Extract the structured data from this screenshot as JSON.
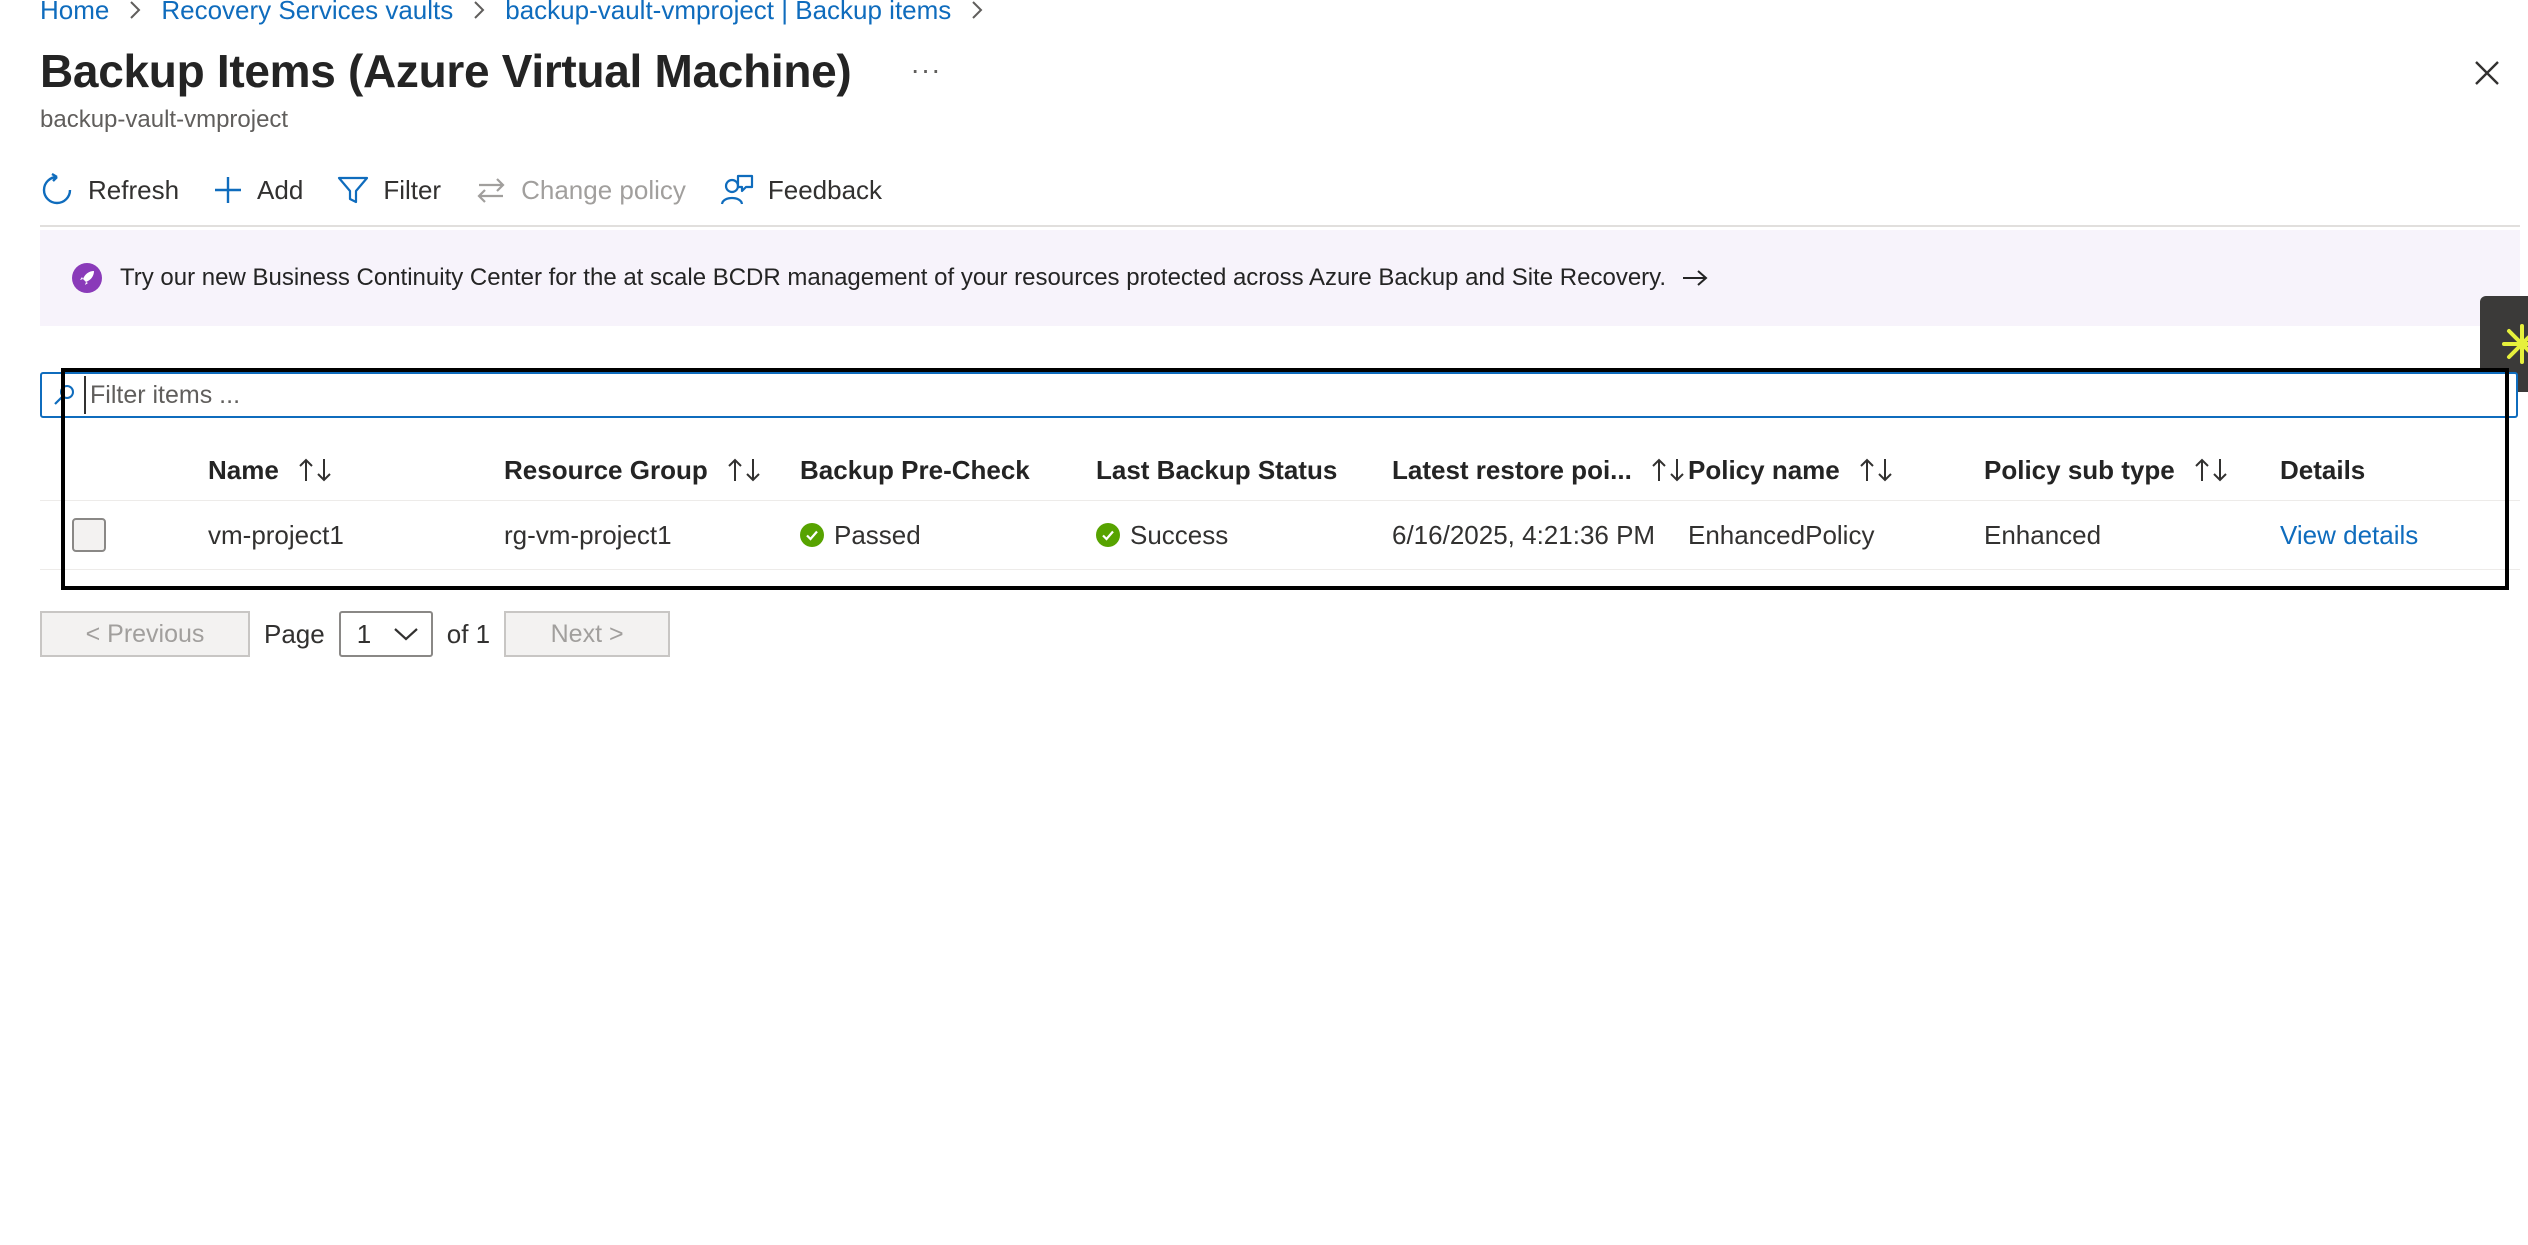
{
  "breadcrumb": {
    "items": [
      "Home",
      "Recovery Services vaults",
      "backup-vault-vmproject | Backup items"
    ]
  },
  "header": {
    "title": "Backup Items (Azure Virtual Machine)",
    "more_label": "···",
    "subtitle": "backup-vault-vmproject"
  },
  "toolbar": {
    "refresh": "Refresh",
    "add": "Add",
    "filter": "Filter",
    "change_policy": "Change policy",
    "feedback": "Feedback"
  },
  "banner": {
    "text": "Try our new Business Continuity Center for the at scale BCDR management of your resources protected across Azure Backup and Site Recovery."
  },
  "filter": {
    "placeholder": "Filter items ..."
  },
  "table": {
    "columns": [
      "Name",
      "Resource Group",
      "Backup Pre-Check",
      "Last Backup Status",
      "Latest restore poi...",
      "Policy name",
      "Policy sub type",
      "Details"
    ],
    "rows": [
      {
        "name": "vm-project1",
        "resource_group": "rg-vm-project1",
        "pre_check": "Passed",
        "last_status": "Success",
        "latest_restore": "6/16/2025, 4:21:36 PM",
        "policy_name": "EnhancedPolicy",
        "policy_sub_type": "Enhanced",
        "details": "View details"
      }
    ]
  },
  "pagination": {
    "previous": "< Previous",
    "page_label": "Page",
    "page_value": "1",
    "of_label": "of 1",
    "next": "Next >"
  },
  "colors": {
    "link": "#0f6cbd",
    "success": "#57a300",
    "banner_bg": "#f7f3fb",
    "banner_icon": "#8a3ab9"
  }
}
